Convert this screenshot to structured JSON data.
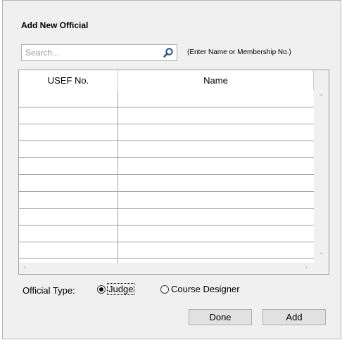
{
  "dialog": {
    "title": "Add New Official",
    "search": {
      "placeholder": "Search...",
      "value": ""
    },
    "search_hint": "(Enter Name or Membership No.)",
    "grid": {
      "columns": [
        "USEF No.",
        "Name"
      ],
      "rows": []
    },
    "official_type": {
      "label": "Official Type:",
      "options": [
        "Judge",
        "Course Designer"
      ],
      "selected": "Judge"
    },
    "buttons": {
      "done": "Done",
      "add": "Add"
    }
  },
  "colors": {
    "dialog_bg": "#f0f0f0",
    "accent_icon": "#1f4e8c",
    "border": "#a0a0a0"
  },
  "icons": {
    "search": "search-icon",
    "scroll_up": "chevron-up-icon",
    "scroll_down": "chevron-down-icon",
    "scroll_left": "chevron-left-icon",
    "scroll_right": "chevron-right-icon"
  }
}
